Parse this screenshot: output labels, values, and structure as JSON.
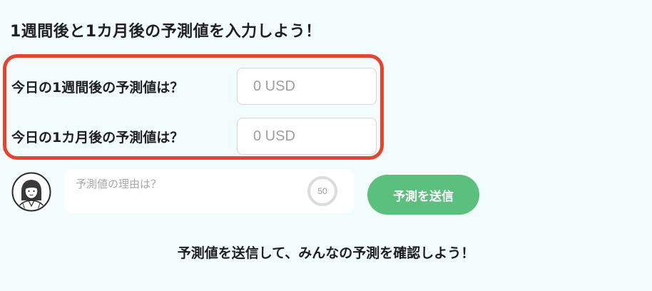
{
  "heading": "1週間後と1カ月後の予測値を入力しよう！",
  "fields": [
    {
      "label": "今日の1週間後の予測値は？",
      "placeholder": "0 USD",
      "value": ""
    },
    {
      "label": "今日の1カ月後の予測値は？",
      "placeholder": "0 USD",
      "value": ""
    }
  ],
  "reason": {
    "placeholder": "予測値の理由は？",
    "remaining_chars": "50"
  },
  "submit_label": "予測を送信",
  "footer_text": "予測値を送信して、みんなの予測を確認しよう！",
  "colors": {
    "background": "#f2fcfd",
    "highlight_border": "#e8432e",
    "submit_button": "#5bbf7e"
  },
  "icons": {
    "avatar": "user-avatar-icon",
    "counter": "character-counter-ring"
  }
}
